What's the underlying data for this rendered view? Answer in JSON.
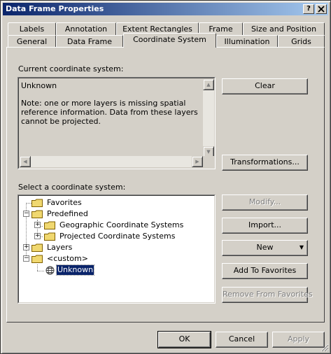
{
  "window": {
    "title": "Data Frame Properties",
    "help_label": "?",
    "close_label": "X"
  },
  "tabs": {
    "row_back": [
      "Labels",
      "Annotation",
      "Extent Rectangles",
      "Frame",
      "Size and Position"
    ],
    "row_front": [
      "General",
      "Data Frame",
      "Coordinate System",
      "Illumination",
      "Grids"
    ],
    "active": "Coordinate System"
  },
  "current_cs": {
    "label": "Current coordinate system:",
    "name": "Unknown",
    "note_line1": "Note: one or more layers is missing spatial",
    "note_line2": "reference information.  Data from these layers",
    "note_line3": "cannot be projected."
  },
  "buttons": {
    "clear": "Clear",
    "transformations": "Transformations...",
    "modify": "Modify...",
    "import": "Import...",
    "new": "New",
    "add_to_favorites": "Add To Favorites",
    "remove_from_favorites": "Remove From Favorites",
    "ok": "OK",
    "cancel": "Cancel",
    "apply": "Apply"
  },
  "select_cs": {
    "label": "Select a coordinate system:",
    "tree": {
      "favorites": "Favorites",
      "predefined": "Predefined",
      "geographic": "Geographic Coordinate Systems",
      "projected": "Projected Coordinate Systems",
      "layers": "Layers",
      "custom": "<custom>",
      "unknown": "Unknown"
    }
  },
  "icons": {
    "folder": "folder-icon",
    "globe": "globe-icon",
    "dropdown": "dropdown-arrow-icon"
  },
  "colors": {
    "face": "#d4d0c8",
    "title_start": "#0a246a",
    "title_end": "#a6caf0",
    "selection": "#0a246a",
    "folder": "#f0d870"
  }
}
